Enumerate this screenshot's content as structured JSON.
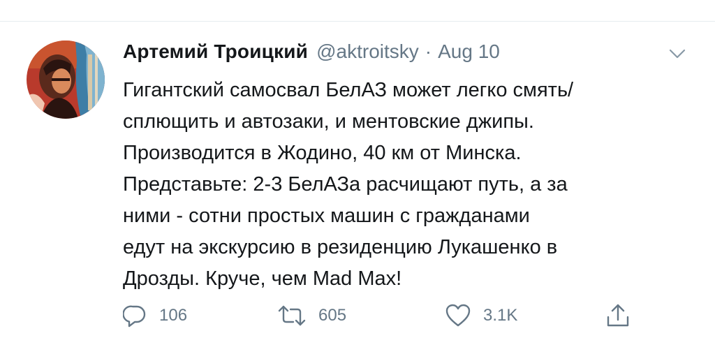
{
  "tweet": {
    "author_name": "Артемий Троицкий",
    "handle": "@aktroitsky",
    "separator": "·",
    "date": "Aug 10",
    "text_lines": [
      "Гигантский самосвал БелАЗ может легко смять/",
      "сплющить и автозаки, и ментовские джипы.",
      "Производится в Жодино, 40 км от Минска.",
      "Представьте: 2-3 БелАЗа расчищают путь, а за",
      "ними - сотни простых машин с гражданами",
      "едут на экскурсию в резиденцию Лукашенко в",
      "Дрозды. Круче, чем Mad Max!"
    ]
  },
  "actions": {
    "reply": {
      "icon": "reply-icon",
      "count": "106"
    },
    "retweet": {
      "icon": "retweet-icon",
      "count": "605"
    },
    "like": {
      "icon": "heart-icon",
      "count": "3.1K"
    },
    "share": {
      "icon": "share-icon"
    }
  },
  "menu": {
    "icon": "chevron-down-icon"
  },
  "colors": {
    "text": "#14171a",
    "secondary": "#657786",
    "divider": "#e6ecf0"
  }
}
